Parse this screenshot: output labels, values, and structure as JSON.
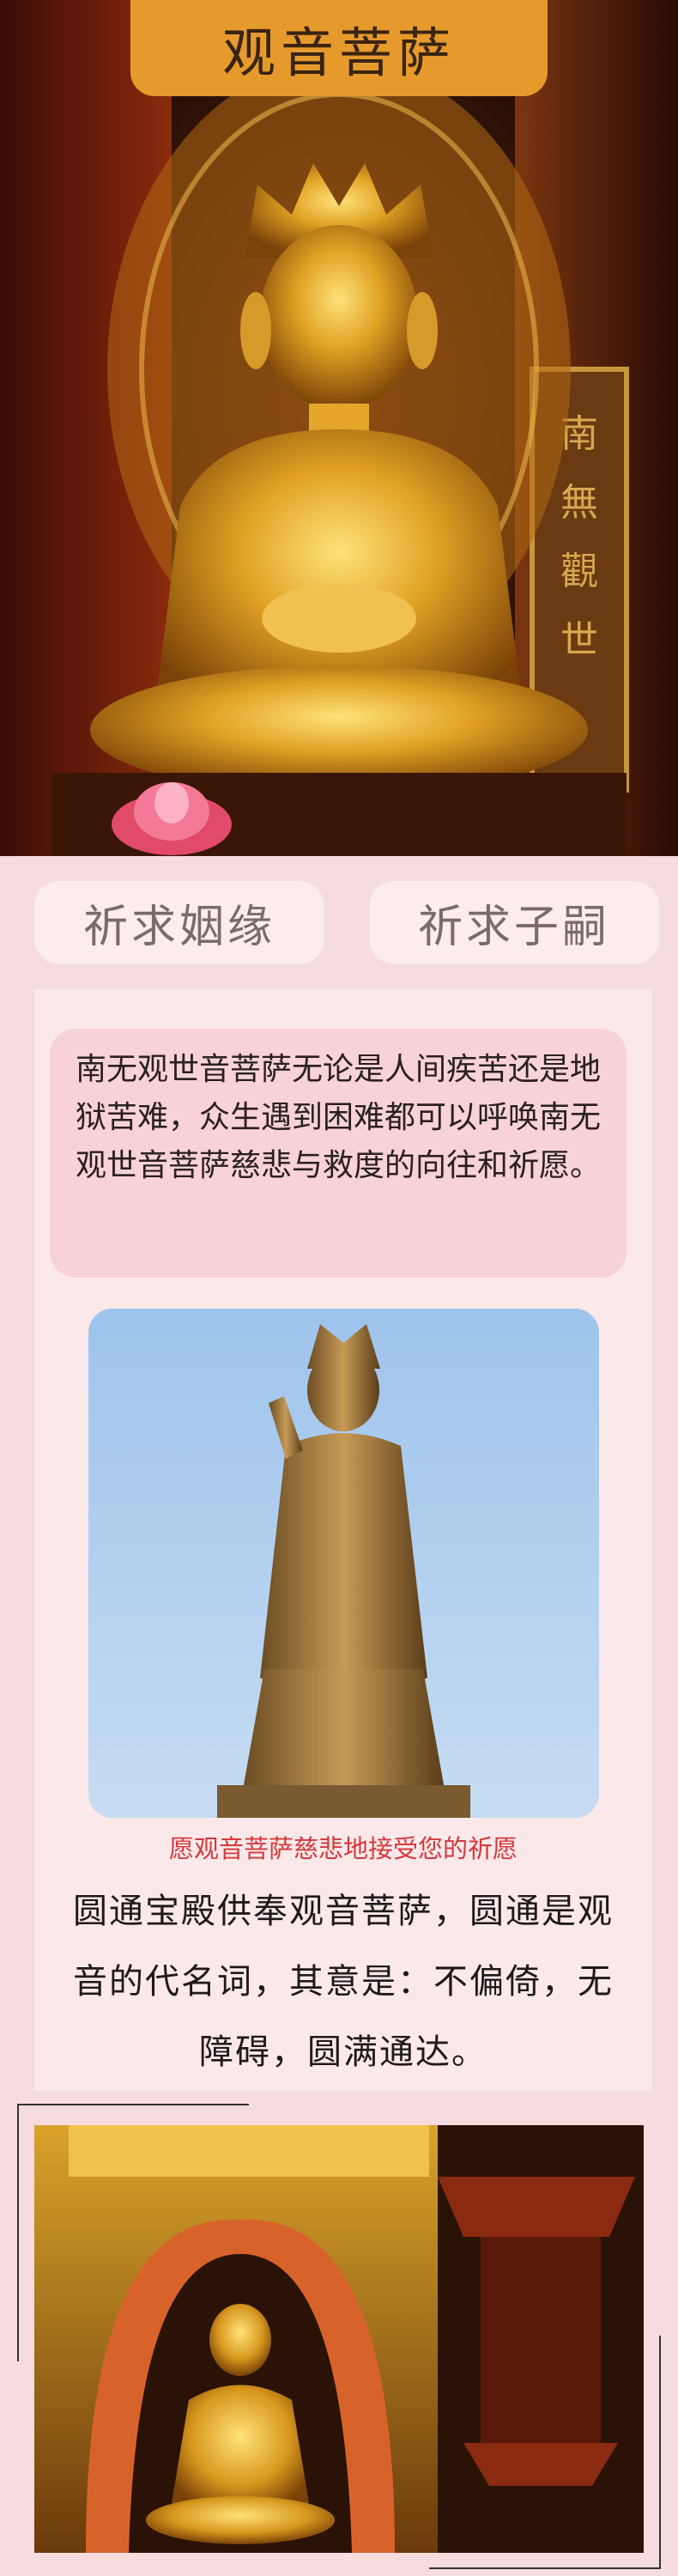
{
  "header": {
    "title": "观音菩萨"
  },
  "tabs": [
    {
      "label": "祈求姻缘"
    },
    {
      "label": "祈求子嗣"
    }
  ],
  "intro": {
    "text": "南无观世音菩萨无论是人间疾苦还是地狱苦难，众生遇到困难都可以呼唤南无观世音菩萨慈悲与救度的向往和祈愿。"
  },
  "statue_photo": {
    "caption": "愿观音菩萨慈悲地接受您的祈愿"
  },
  "description": {
    "text": "圆通宝殿供奉观音菩萨，圆通是观音的代名词，其意是：不偏倚，无障碍，圆满通达。"
  },
  "colors": {
    "accent": "#e69a2c",
    "background": "#f6dcde",
    "caption": "#d6373a"
  },
  "icons": [
    "hero-statue-image",
    "standing-statue-image",
    "shrine-image"
  ]
}
